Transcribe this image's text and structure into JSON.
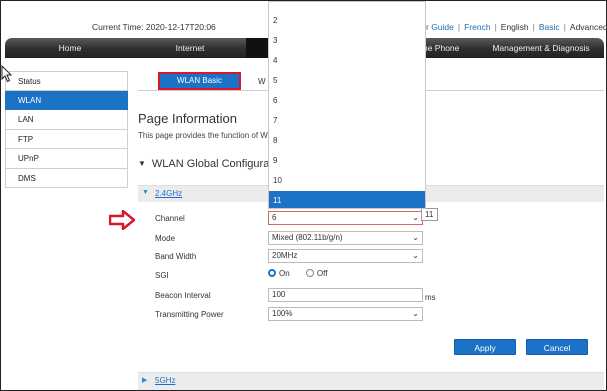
{
  "header": {
    "current_time": "Current Time: 2020-12-17T20:06",
    "links": [
      {
        "label": "r Guide",
        "kind": "link"
      },
      {
        "label": "French",
        "kind": "link"
      },
      {
        "label": "English",
        "kind": "plain"
      },
      {
        "label": "Basic",
        "kind": "link"
      },
      {
        "label": "Advanced",
        "kind": "plain"
      }
    ]
  },
  "nav": {
    "items": [
      "Home",
      "Internet",
      "",
      "me Phone",
      "Management & Diagnosis"
    ],
    "active_index": 2
  },
  "sidebar": {
    "items": [
      "Status",
      "WLAN",
      "LAN",
      "FTP",
      "UPnP",
      "DMS"
    ],
    "active_index": 1
  },
  "tabs": {
    "active": "WLAN Basic",
    "other": "W"
  },
  "page": {
    "title": "Page Information",
    "description": "This page provides the function of W",
    "section_title": "WLAN Global Configura"
  },
  "band_24": {
    "label": "2.4GHz"
  },
  "band_5": {
    "label": "5GHz"
  },
  "form": {
    "channel": {
      "label": "Channel",
      "value": "6",
      "tooltip": "11"
    },
    "mode": {
      "label": "Mode",
      "value": "Mixed (802.11b/g/n)"
    },
    "bandwidth": {
      "label": "Band Width",
      "value": "20MHz"
    },
    "sgi": {
      "label": "SGI",
      "on_label": "On",
      "off_label": "Off",
      "selected": "On"
    },
    "beacon": {
      "label": "Beacon Interval",
      "value": "100",
      "unit": "ms"
    },
    "power": {
      "label": "Transmitting Power",
      "value": "100%"
    }
  },
  "buttons": {
    "apply": "Apply",
    "cancel": "Cancel"
  },
  "channel_dropdown": {
    "options": [
      "2",
      "3",
      "4",
      "5",
      "6",
      "7",
      "8",
      "9",
      "10",
      "11"
    ],
    "highlighted": "11"
  },
  "colors": {
    "accent": "#1b72c7",
    "navbar": "#2e2e2e",
    "highlight_border": "#d8182a",
    "arrow": "#d8182a"
  }
}
